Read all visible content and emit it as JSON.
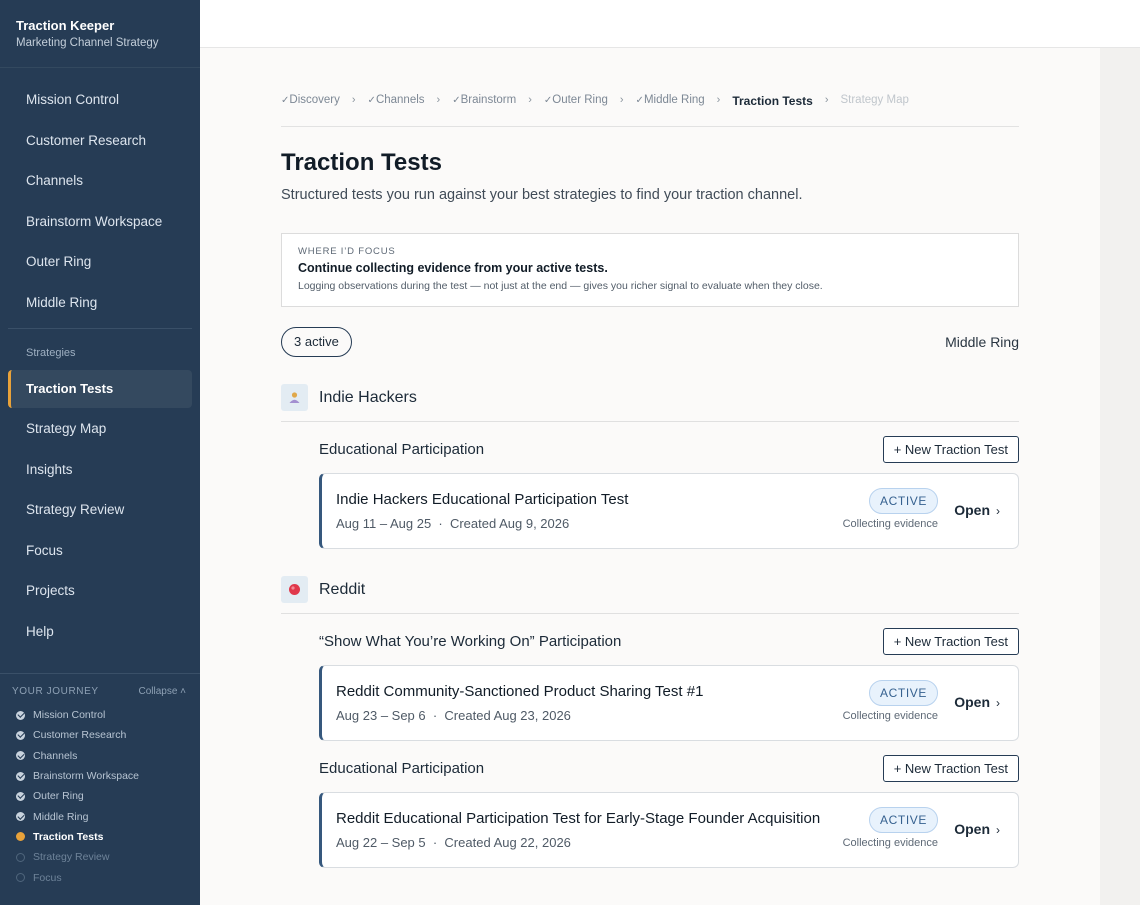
{
  "brand": {
    "title": "Traction Keeper",
    "subtitle": "Marketing Channel Strategy"
  },
  "nav": {
    "top_items": [
      "Mission Control",
      "Customer Research",
      "Channels",
      "Brainstorm Workspace",
      "Outer Ring",
      "Middle Ring"
    ],
    "section_label": "Strategies",
    "bottom_items": [
      "Traction Tests",
      "Strategy Map",
      "Insights",
      "Strategy Review",
      "Focus",
      "Projects",
      "Help"
    ],
    "active": "Traction Tests"
  },
  "journey": {
    "heading": "YOUR JOURNEY",
    "collapse_label": "Collapse ˄",
    "steps": [
      {
        "label": "Mission Control",
        "state": "done"
      },
      {
        "label": "Customer Research",
        "state": "done"
      },
      {
        "label": "Channels",
        "state": "done"
      },
      {
        "label": "Brainstorm Workspace",
        "state": "done"
      },
      {
        "label": "Outer Ring",
        "state": "done"
      },
      {
        "label": "Middle Ring",
        "state": "done"
      },
      {
        "label": "Traction Tests",
        "state": "current"
      },
      {
        "label": "Strategy Review",
        "state": "todo"
      },
      {
        "label": "Focus",
        "state": "todo"
      }
    ]
  },
  "breadcrumb": {
    "items": [
      {
        "label": "Discovery",
        "state": "done"
      },
      {
        "label": "Channels",
        "state": "done"
      },
      {
        "label": "Brainstorm",
        "state": "done"
      },
      {
        "label": "Outer Ring",
        "state": "done"
      },
      {
        "label": "Middle Ring",
        "state": "done"
      },
      {
        "label": "Traction Tests",
        "state": "current"
      },
      {
        "label": "Strategy Map",
        "state": "future"
      }
    ],
    "separator": "›"
  },
  "page": {
    "title": "Traction Tests",
    "subtitle": "Structured tests you run against your best strategies to find your traction channel."
  },
  "focus": {
    "kicker": "WHERE I’D FOCUS",
    "headline": "Continue collecting evidence from your active tests.",
    "body": "Logging observations during the test — not just at the end — gives you richer signal to evaluate when they close."
  },
  "filters": {
    "active_pill": "3 active",
    "ring_label": "Middle Ring"
  },
  "new_test_label": "+ New Traction Test",
  "open_label": "Open",
  "channels": [
    {
      "name": "Indie Hackers",
      "icon": "indie-hackers-icon",
      "strategies": [
        {
          "name": "Educational Participation",
          "tests": [
            {
              "title": "Indie Hackers Educational Participation Test",
              "dates": "Aug 11 – Aug 25",
              "created": "Created Aug 9, 2026",
              "badge": "ACTIVE",
              "status": "Collecting evidence"
            }
          ]
        }
      ]
    },
    {
      "name": "Reddit",
      "icon": "reddit-icon",
      "strategies": [
        {
          "name": "“Show What You’re Working On” Participation",
          "tests": [
            {
              "title": "Reddit Community-Sanctioned Product Sharing Test #1",
              "dates": "Aug 23 – Sep 6",
              "created": "Created Aug 23, 2026",
              "badge": "ACTIVE",
              "status": "Collecting evidence"
            }
          ]
        },
        {
          "name": "Educational Participation",
          "tests": [
            {
              "title": "Reddit Educational Participation Test for Early-Stage Founder Acquisition",
              "dates": "Aug 22 – Sep 5",
              "created": "Created Aug 22, 2026",
              "badge": "ACTIVE",
              "status": "Collecting evidence"
            }
          ]
        }
      ]
    }
  ],
  "colors": {
    "sidebar": "#263c55",
    "accent": "#e8a23a",
    "badge_bg": "#e8f2fc",
    "reddit": "#e0384b"
  }
}
